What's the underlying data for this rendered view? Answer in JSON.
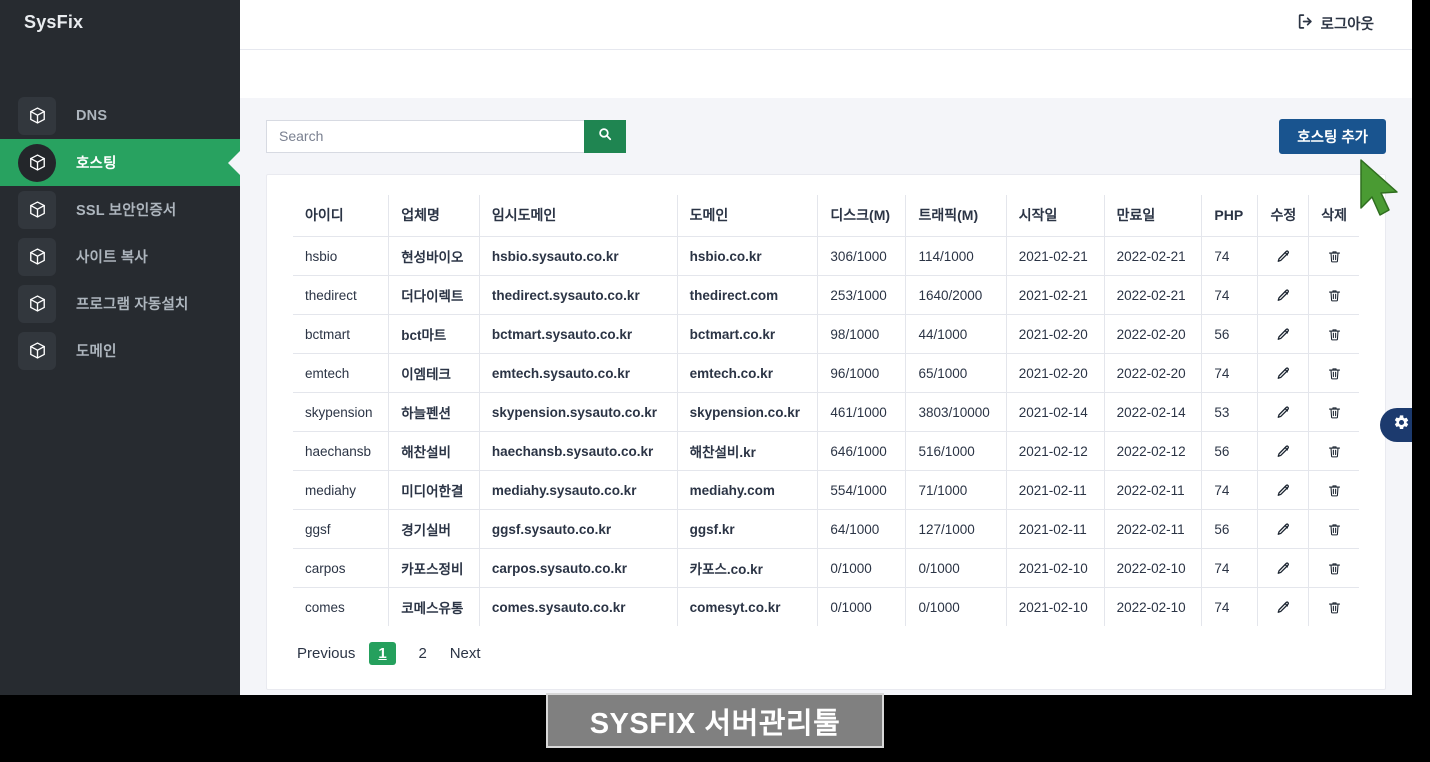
{
  "app": {
    "brand": "SysFix",
    "caption": "SYSFIX 서버관리툴"
  },
  "colors": {
    "sidebar_bg": "#272b30",
    "active_green": "#28a260",
    "search_btn_green": "#1f8551",
    "add_btn_blue": "#19548f",
    "pager_active_green": "#25a05d",
    "gear_navy": "#1c3a6e",
    "cursor_green": "#4a9b33",
    "caption_grey": "#808080"
  },
  "sidebar": {
    "items": [
      {
        "label": "DNS",
        "icon": "cube-icon",
        "active": false
      },
      {
        "label": "호스팅",
        "icon": "cube-icon",
        "active": true
      },
      {
        "label": "SSL 보안인증서",
        "icon": "cube-icon",
        "active": false
      },
      {
        "label": "사이트 복사",
        "icon": "cube-icon",
        "active": false
      },
      {
        "label": "프로그램 자동설치",
        "icon": "cube-icon",
        "active": false
      },
      {
        "label": "도메인",
        "icon": "cube-icon",
        "active": false
      }
    ]
  },
  "topbar": {
    "logout_label": "로그아웃",
    "logout_icon": "sign-out-icon"
  },
  "toolbar": {
    "search_placeholder": "Search",
    "search_value": "",
    "search_icon": "search-icon",
    "add_label": "호스팅 추가"
  },
  "table": {
    "headers": [
      "아이디",
      "업체명",
      "임시도메인",
      "도메인",
      "디스크(M)",
      "트래픽(M)",
      "시작일",
      "만료일",
      "PHP",
      "수정",
      "삭제"
    ],
    "edit_icon": "pencil-icon",
    "delete_icon": "trash-icon",
    "rows": [
      {
        "id": "hsbio",
        "company": "현성바이오",
        "temp_domain": "hsbio.sysauto.co.kr",
        "domain": "hsbio.co.kr",
        "disk": "306/1000",
        "traffic": "114/1000",
        "start": "2021-02-21",
        "expire": "2022-02-21",
        "php": "74"
      },
      {
        "id": "thedirect",
        "company": "더다이렉트",
        "temp_domain": "thedirect.sysauto.co.kr",
        "domain": "thedirect.com",
        "disk": "253/1000",
        "traffic": "1640/2000",
        "start": "2021-02-21",
        "expire": "2022-02-21",
        "php": "74"
      },
      {
        "id": "bctmart",
        "company": "bct마트",
        "temp_domain": "bctmart.sysauto.co.kr",
        "domain": "bctmart.co.kr",
        "disk": "98/1000",
        "traffic": "44/1000",
        "start": "2021-02-20",
        "expire": "2022-02-20",
        "php": "56"
      },
      {
        "id": "emtech",
        "company": "이엠테크",
        "temp_domain": "emtech.sysauto.co.kr",
        "domain": "emtech.co.kr",
        "disk": "96/1000",
        "traffic": "65/1000",
        "start": "2021-02-20",
        "expire": "2022-02-20",
        "php": "74"
      },
      {
        "id": "skypension",
        "company": "하늘펜션",
        "temp_domain": "skypension.sysauto.co.kr",
        "domain": "skypension.co.kr",
        "disk": "461/1000",
        "traffic": "3803/10000",
        "start": "2021-02-14",
        "expire": "2022-02-14",
        "php": "53"
      },
      {
        "id": "haechansb",
        "company": "해찬설비",
        "temp_domain": "haechansb.sysauto.co.kr",
        "domain": "해찬설비.kr",
        "disk": "646/1000",
        "traffic": "516/1000",
        "start": "2021-02-12",
        "expire": "2022-02-12",
        "php": "56"
      },
      {
        "id": "mediahy",
        "company": "미디어한결",
        "temp_domain": "mediahy.sysauto.co.kr",
        "domain": "mediahy.com",
        "disk": "554/1000",
        "traffic": "71/1000",
        "start": "2021-02-11",
        "expire": "2022-02-11",
        "php": "74"
      },
      {
        "id": "ggsf",
        "company": "경기실버",
        "temp_domain": "ggsf.sysauto.co.kr",
        "domain": "ggsf.kr",
        "disk": "64/1000",
        "traffic": "127/1000",
        "start": "2021-02-11",
        "expire": "2022-02-11",
        "php": "56"
      },
      {
        "id": "carpos",
        "company": "카포스정비",
        "temp_domain": "carpos.sysauto.co.kr",
        "domain": "카포스.co.kr",
        "disk": "0/1000",
        "traffic": "0/1000",
        "start": "2021-02-10",
        "expire": "2022-02-10",
        "php": "74"
      },
      {
        "id": "comes",
        "company": "코메스유통",
        "temp_domain": "comes.sysauto.co.kr",
        "domain": "comesyt.co.kr",
        "disk": "0/1000",
        "traffic": "0/1000",
        "start": "2021-02-10",
        "expire": "2022-02-10",
        "php": "74"
      }
    ]
  },
  "pagination": {
    "previous": "Previous",
    "pages": [
      "1",
      "2"
    ],
    "active_page": "1",
    "next": "Next"
  },
  "gear_tab": {
    "icon": "gear-icon"
  }
}
